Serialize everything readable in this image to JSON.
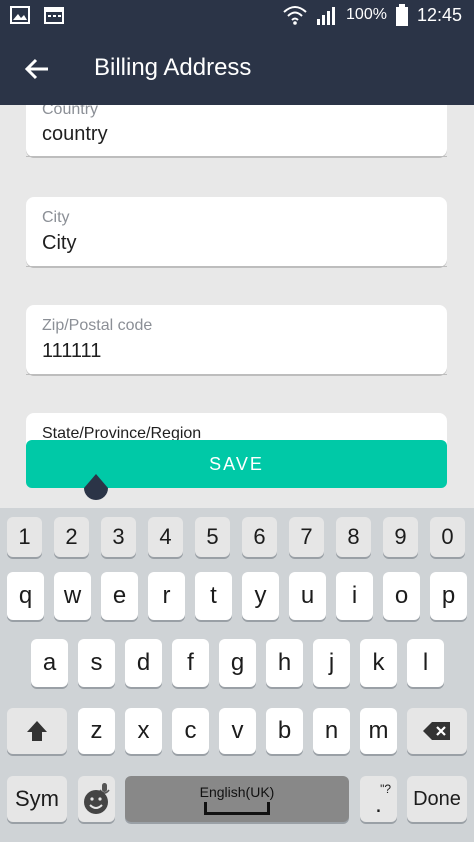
{
  "status": {
    "battery": "100%",
    "time": "12:45"
  },
  "appbar": {
    "title": "Billing Address"
  },
  "form": {
    "fields": [
      {
        "label": "Country",
        "value": "country"
      },
      {
        "label": "City",
        "value": "City"
      },
      {
        "label": "Zip/Postal code",
        "value": "111111"
      },
      {
        "label": "State/Province/Region",
        "value": ""
      }
    ],
    "save_label": "SAVE"
  },
  "keyboard": {
    "numbers": [
      "1",
      "2",
      "3",
      "4",
      "5",
      "6",
      "7",
      "8",
      "9",
      "0"
    ],
    "row1": [
      "q",
      "w",
      "e",
      "r",
      "t",
      "y",
      "u",
      "i",
      "o",
      "p"
    ],
    "row2": [
      "a",
      "s",
      "d",
      "f",
      "g",
      "h",
      "j",
      "k",
      "l"
    ],
    "row3": [
      "z",
      "x",
      "c",
      "v",
      "b",
      "n",
      "m"
    ],
    "sym_label": "Sym",
    "space_label": "English(UK)",
    "dot_label": ".",
    "dot_hint": "\"?",
    "done_label": "Done"
  },
  "colors": {
    "header_bg": "#2b3447",
    "accent": "#00c9a7"
  }
}
